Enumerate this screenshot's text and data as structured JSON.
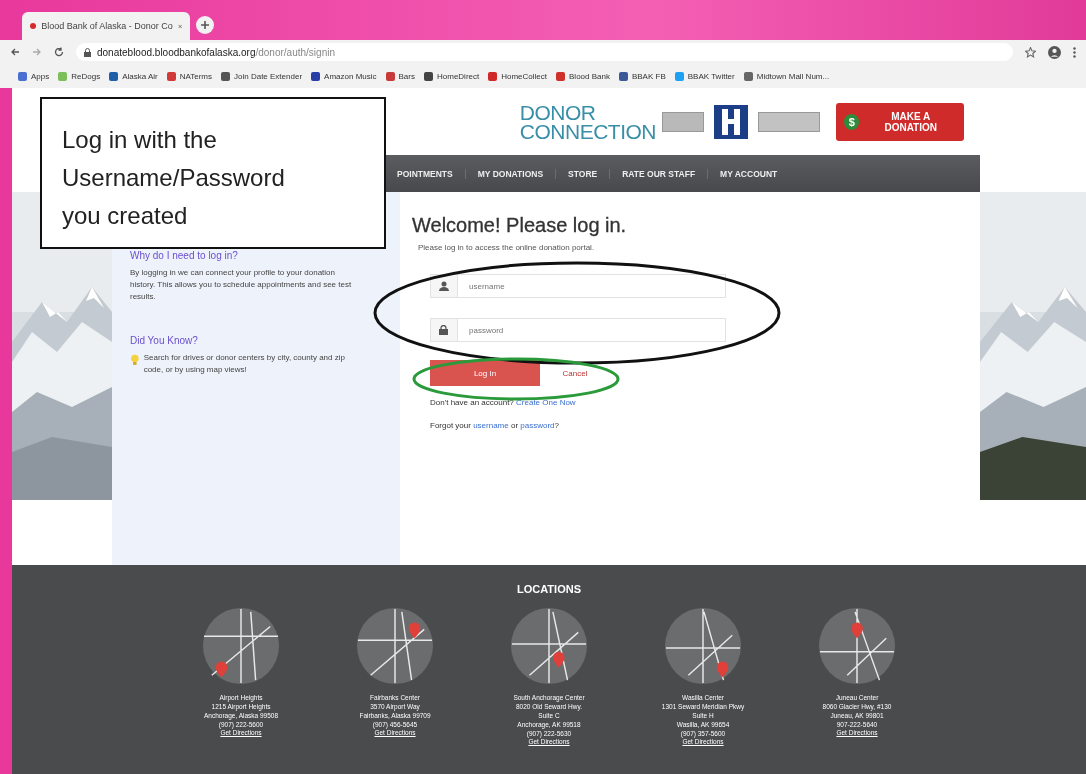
{
  "browser": {
    "tab": {
      "title": "Blood Bank of Alaska - Donor Co"
    },
    "url_host": "donateblood.bloodbankofalaska.org",
    "url_path": "/donor/auth/signin",
    "bookmarks": [
      {
        "label": "Apps",
        "color": "#4a6fd0"
      },
      {
        "label": "ReDogs",
        "color": "#7cbf5a"
      },
      {
        "label": "Alaska Air",
        "color": "#1d5fa8"
      },
      {
        "label": "NATerms",
        "color": "#d23a3a"
      },
      {
        "label": "Join Date Extender",
        "color": "#555555"
      },
      {
        "label": "Amazon Music",
        "color": "#2a3ea8"
      },
      {
        "label": "Bars",
        "color": "#c83a3a"
      },
      {
        "label": "HomeDirect",
        "color": "#444444"
      },
      {
        "label": "HomeCollect",
        "color": "#d02828"
      },
      {
        "label": "Blood Bank",
        "color": "#d0302a"
      },
      {
        "label": "BBAK FB",
        "color": "#3b5998"
      },
      {
        "label": "BBAK Twitter",
        "color": "#1da1f2"
      },
      {
        "label": "Midtown Mall Num...",
        "color": "#666666"
      }
    ]
  },
  "header": {
    "logo_top": "DONOR",
    "logo_bottom": "CONNECTION",
    "donate_button": "MAKE A DONATION",
    "donate_icon": "$"
  },
  "nav": [
    "POINTMENTS",
    "MY DONATIONS",
    "STORE",
    "RATE OUR STAFF",
    "MY ACCOUNT"
  ],
  "sidebar": {
    "sections": [
      {
        "heading": "Why do I need to log in?",
        "text": "By logging in we can connect your profile to your donation history. This allows you to schedule appointments and see test results.",
        "kind": "plain"
      },
      {
        "heading": "Did You Know?",
        "text": "Search for drives or donor centers by city, county and zip code, or by using map views!",
        "kind": "tip"
      }
    ]
  },
  "login": {
    "title": "Welcome! Please log in.",
    "subtitle": "Please log in to access the online donation portal.",
    "username": {
      "placeholder": "username"
    },
    "password": {
      "placeholder": "password"
    },
    "login_button": "Log In",
    "cancel_button": "Cancel",
    "signup_text": "Don't have an account?",
    "signup_link": "Create One Now",
    "forgot_text": "Forgot your",
    "forgot_username": "username",
    "forgot_or": "or",
    "forgot_password": "password",
    "forgot_end": "?"
  },
  "footer": {
    "title": "LOCATIONS",
    "locations": [
      {
        "lines": [
          "Airport Heights",
          "1215 Airport Heights",
          "Anchorage, Alaska 99508",
          "(907) 222-5600"
        ],
        "link": "Get Directions"
      },
      {
        "lines": [
          "Fairbanks Center",
          "3570 Airport Way",
          "Fairbanks, Alaska 99709",
          "(907) 456-5645"
        ],
        "link": "Get Directions"
      },
      {
        "lines": [
          "South Anchorage Center",
          "8020 Old Seward Hwy.",
          "Suite C",
          "Anchorage, AK 99518",
          "(907) 222-5630"
        ],
        "link": "Get Directions"
      },
      {
        "lines": [
          "Wasilla Center",
          "1301 Seward Meridian Pkwy",
          "Suite H",
          "Wasilla, AK 99654",
          "(907) 357-5600"
        ],
        "link": "Get Directions"
      },
      {
        "lines": [
          "Juneau Center",
          "8060 Glacier Hwy, #130",
          "Juneau, AK 99801",
          "907-222-5640"
        ],
        "link": "Get Directions"
      }
    ]
  },
  "annotation": {
    "callout": "Log in with the Username/Password you created"
  }
}
